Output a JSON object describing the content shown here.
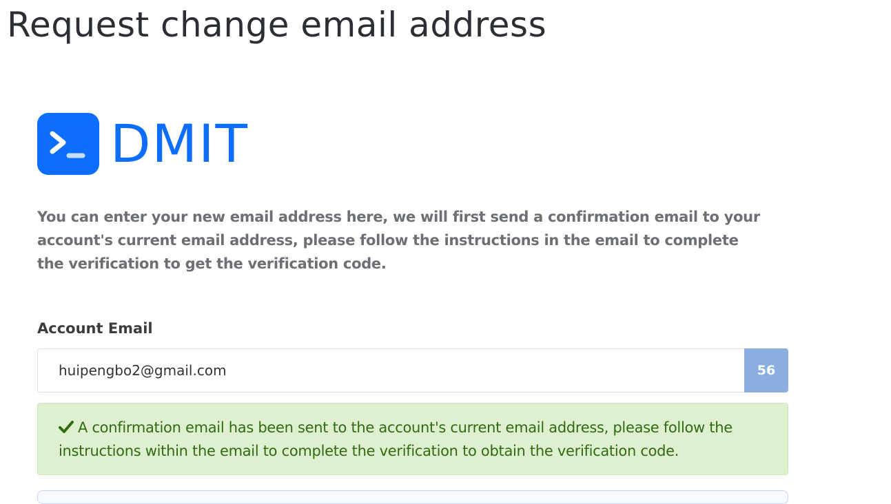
{
  "page": {
    "title": "Request change email address"
  },
  "brand": {
    "name": "DMIT",
    "color": "#0d6efd"
  },
  "intro": {
    "text": "You can enter your new email address here, we will first send a confirmation email to your account's current email address, please follow the instructions in the email to complete the verification to get the verification code."
  },
  "form": {
    "email_label": "Account Email",
    "email_value": "huipengbo2@gmail.com",
    "countdown": "56"
  },
  "alert": {
    "type": "success",
    "icon": "check-icon",
    "message": "A confirmation email has been sent to the account's current email address, please follow the instructions within the email to complete the verification to obtain the verification code."
  }
}
